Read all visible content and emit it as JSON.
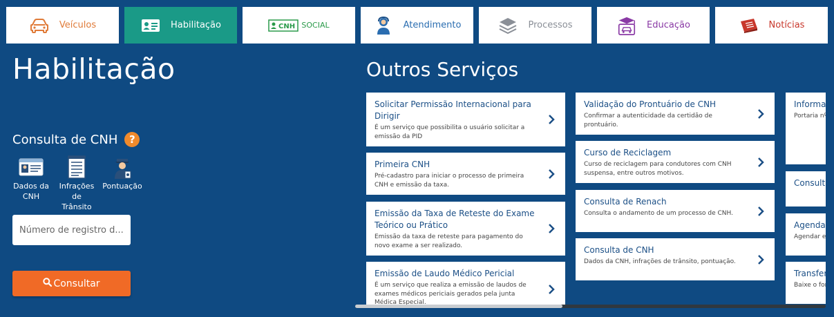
{
  "tabs": [
    {
      "label": "Veículos",
      "icon": "car-icon",
      "color": "#e07b39"
    },
    {
      "label": "Habilitação",
      "icon": "id-card-icon",
      "active": true,
      "color": "#1a9a87"
    },
    {
      "label": "CNH SOCIAL",
      "icon": "cnh-social-logo",
      "color": "#2a9a4a"
    },
    {
      "label": "Atendimento",
      "icon": "attendant-icon",
      "color": "#2a6db0"
    },
    {
      "label": "Processos",
      "icon": "layers-icon",
      "color": "#8a8f97"
    },
    {
      "label": "Educação",
      "icon": "graduation-car-icon",
      "color": "#8a3aa5"
    },
    {
      "label": "Notícias",
      "icon": "news-book-icon",
      "color": "#c8382c"
    }
  ],
  "left": {
    "title": "Habilitação",
    "consulta_title": "Consulta de CNH",
    "help": "?",
    "options": [
      {
        "label": "Dados da CNH",
        "icon": "license-card-icon"
      },
      {
        "label": "Infrações de Trânsito",
        "icon": "document-list-icon"
      },
      {
        "label": "Pontuação",
        "icon": "officer-icon"
      }
    ],
    "input_placeholder": "Número de registro d...",
    "button_label": "Consultar"
  },
  "outros": {
    "title": "Outros Serviços",
    "columns": [
      [
        {
          "title": "Solicitar Permissão Internacional para Dirigir",
          "desc": "É um serviço que possibilita o usuário solicitar a emissão da PID"
        },
        {
          "title": "Primeira CNH",
          "desc": "Pré-cadastro para iniciar o processo de primeira CNH e emissão da taxa."
        },
        {
          "title": "Emissão da Taxa de Reteste do Exame Teórico ou Prático",
          "desc": "Emissão da taxa de reteste para pagamento do novo exame a ser realizado."
        },
        {
          "title": "Emissão de Laudo Médico Pericial",
          "desc": "É um serviço que realiza a emissão de laudos de exames médicos periciais gerados pela junta Médica Especial."
        }
      ],
      [
        {
          "title": "Validação do Prontuário de CNH",
          "desc": "Confirmar a autenticidade da certidão de prontuário."
        },
        {
          "title": "Curso de Reciclagem",
          "desc": "Curso de reciclagem para condutores com CNH suspensa, entre outros motivos."
        },
        {
          "title": "Consulta de Renach",
          "desc": "Consulta o andamento de um processo de CNH."
        },
        {
          "title": "Consulta de CNH",
          "desc": "Dados da CNH, infrações de trânsito, pontuação."
        }
      ],
      [
        {
          "title": "Informações para Estrangeiros",
          "desc": "Portaria nº Habilitação Convenção Reciprocidade"
        },
        {
          "title": "Consulta Teórico",
          "desc": ""
        },
        {
          "title": "Agendamento",
          "desc": "Agendar e primeira CNH"
        },
        {
          "title": "Transferência",
          "desc": "Baixe o formulário condutor in"
        }
      ]
    ]
  }
}
